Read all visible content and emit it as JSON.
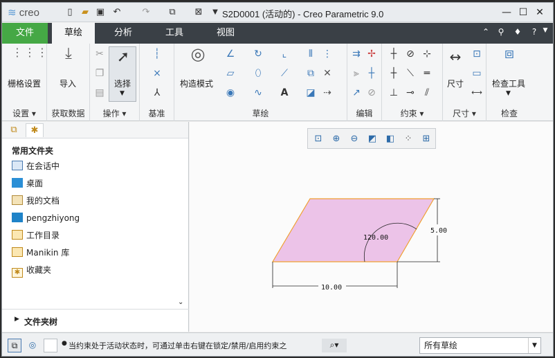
{
  "window": {
    "logo": "creo",
    "title": "S2D0001 (活动的) - Creo Parametric 9.0"
  },
  "tabs": [
    "文件",
    "草绘",
    "分析",
    "工具",
    "视图"
  ],
  "ribbon": {
    "setup": {
      "button": "栅格设置",
      "group": "设置"
    },
    "data": {
      "button": "导入",
      "group": "获取数据"
    },
    "ops": {
      "button": "选择",
      "group": "操作"
    },
    "datum": {
      "group": "基准"
    },
    "sketch": {
      "button": "构造模式",
      "group": "草绘"
    },
    "edit": {
      "group": "编辑"
    },
    "constraint": {
      "group": "约束"
    },
    "dimension": {
      "button": "尺寸",
      "group": "尺寸"
    },
    "inspect": {
      "button": "检查工具",
      "group": "检查"
    }
  },
  "left_panel": {
    "favorites_header": "常用文件夹",
    "items": [
      "在会话中",
      "桌面",
      "我的文档",
      "pengzhiyong",
      "工作目录",
      "Manikin 库",
      "收藏夹"
    ],
    "folder_tree": "文件夹树"
  },
  "sketch": {
    "dim_width": "10.00",
    "dim_height": "5.00",
    "dim_angle": "120.00",
    "fill_color": "#ecc3e8",
    "edge_color": "#f0a030"
  },
  "status": {
    "message": "当约束处于活动状态时，可通过单击右键在锁定/禁用/启用约束之",
    "filter": "所有草绘"
  },
  "colors": {
    "file_tab": "#45a845",
    "tab_bar": "#3a4046"
  }
}
